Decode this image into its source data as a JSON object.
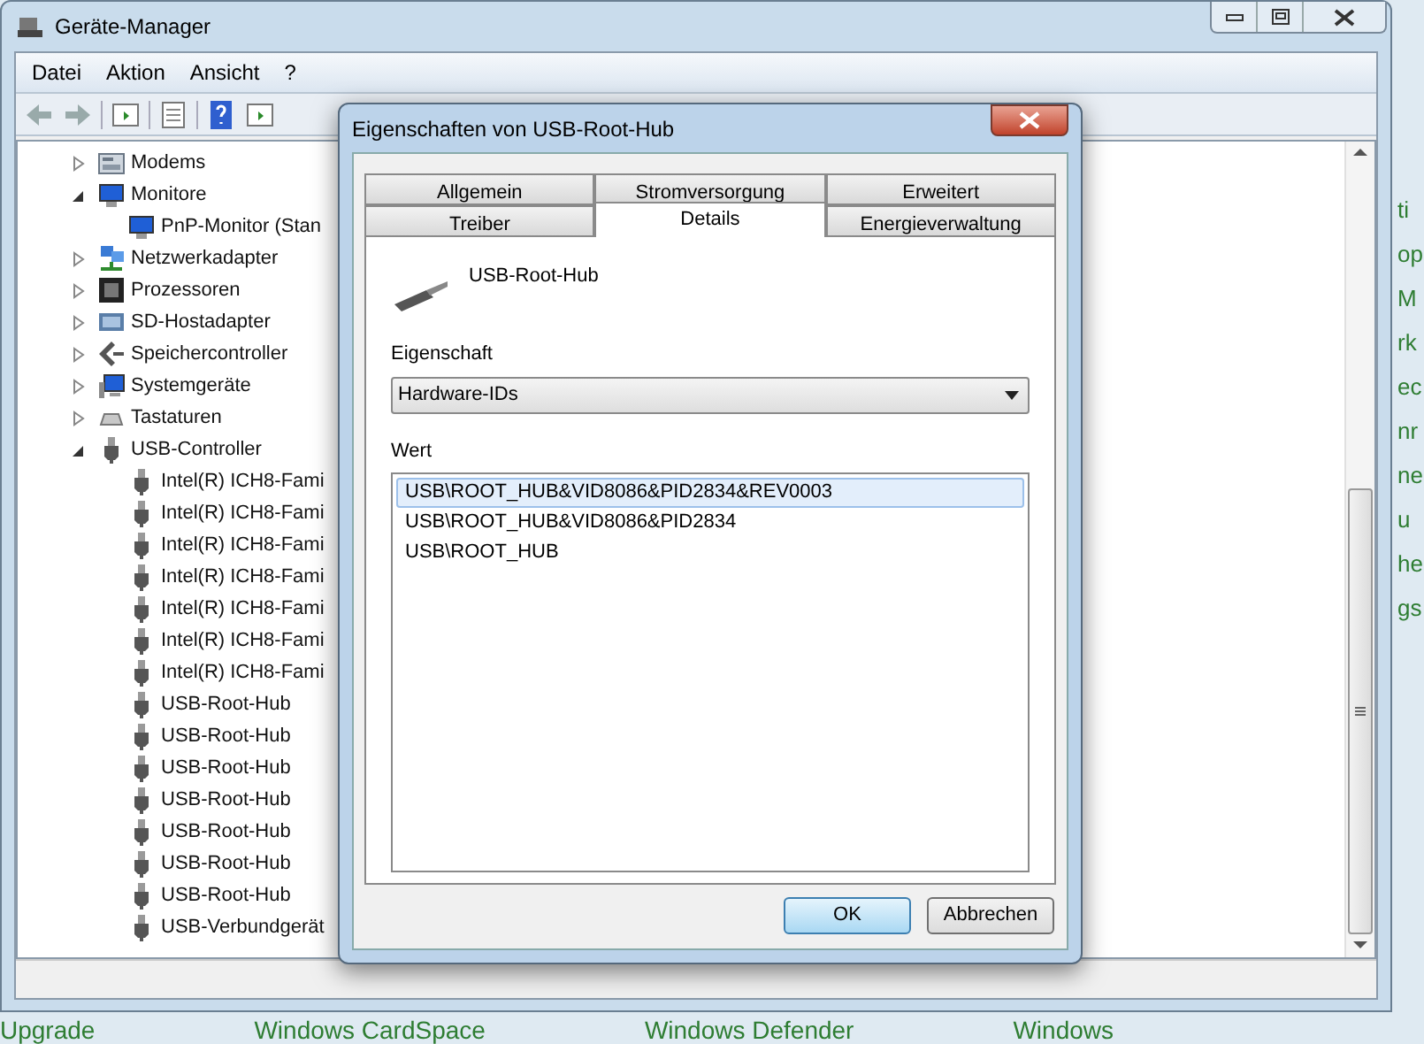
{
  "window": {
    "title": "Geräte-Manager"
  },
  "menu": [
    "Datei",
    "Aktion",
    "Ansicht",
    "?"
  ],
  "tree": [
    {
      "label": "Modems",
      "kind": "modem",
      "expanded": false
    },
    {
      "label": "Monitore",
      "kind": "monitor",
      "expanded": true,
      "children": [
        {
          "label": "PnP-Monitor (Stan",
          "kind": "monitor"
        }
      ]
    },
    {
      "label": "Netzwerkadapter",
      "kind": "network",
      "expanded": false
    },
    {
      "label": "Prozessoren",
      "kind": "cpu",
      "expanded": false
    },
    {
      "label": "SD-Hostadapter",
      "kind": "card",
      "expanded": false
    },
    {
      "label": "Speichercontroller",
      "kind": "storage",
      "expanded": false
    },
    {
      "label": "Systemgeräte",
      "kind": "system",
      "expanded": false
    },
    {
      "label": "Tastaturen",
      "kind": "keyboard",
      "expanded": false
    },
    {
      "label": "USB-Controller",
      "kind": "usb",
      "expanded": true,
      "children": [
        {
          "label": "Intel(R) ICH8-Fami",
          "kind": "usb"
        },
        {
          "label": "Intel(R) ICH8-Fami",
          "kind": "usb"
        },
        {
          "label": "Intel(R) ICH8-Fami",
          "kind": "usb"
        },
        {
          "label": "Intel(R) ICH8-Fami",
          "kind": "usb"
        },
        {
          "label": "Intel(R) ICH8-Fami",
          "kind": "usb"
        },
        {
          "label": "Intel(R) ICH8-Fami",
          "kind": "usb"
        },
        {
          "label": "Intel(R) ICH8-Fami",
          "kind": "usb"
        },
        {
          "label": "USB-Root-Hub",
          "kind": "usb"
        },
        {
          "label": "USB-Root-Hub",
          "kind": "usb"
        },
        {
          "label": "USB-Root-Hub",
          "kind": "usb"
        },
        {
          "label": "USB-Root-Hub",
          "kind": "usb"
        },
        {
          "label": "USB-Root-Hub",
          "kind": "usb"
        },
        {
          "label": "USB-Root-Hub",
          "kind": "usb"
        },
        {
          "label": "USB-Root-Hub",
          "kind": "usb"
        },
        {
          "label": "USB-Verbundgerät",
          "kind": "usb"
        }
      ]
    }
  ],
  "dialog": {
    "title": "Eigenschaften von USB-Root-Hub",
    "tab_rows": [
      [
        {
          "label": "Allgemein",
          "selected": false
        },
        {
          "label": "Stromversorgung",
          "selected": false
        },
        {
          "label": "Erweitert",
          "selected": false
        }
      ],
      [
        {
          "label": "Treiber",
          "selected": false
        },
        {
          "label": "Details",
          "selected": true
        },
        {
          "label": "Energieverwaltung",
          "selected": false
        }
      ]
    ],
    "device_name": "USB-Root-Hub",
    "property_label": "Eigenschaft",
    "property_value": "Hardware-IDs",
    "value_label": "Wert",
    "values": [
      {
        "text": "USB\\ROOT_HUB&VID8086&PID2834&REV0003",
        "selected": true
      },
      {
        "text": "USB\\ROOT_HUB&VID8086&PID2834",
        "selected": false
      },
      {
        "text": "USB\\ROOT_HUB",
        "selected": false
      }
    ],
    "buttons": [
      "OK",
      "Abbrechen"
    ]
  },
  "background": {
    "right_fragments": [
      "ti",
      "op",
      "M",
      "rk",
      "ec",
      "nr",
      "ne",
      "u",
      "he",
      "gs"
    ],
    "bottom_texts": [
      "Upgrade",
      "Windows CardSpace",
      "Windows Defender",
      "Windows"
    ]
  }
}
